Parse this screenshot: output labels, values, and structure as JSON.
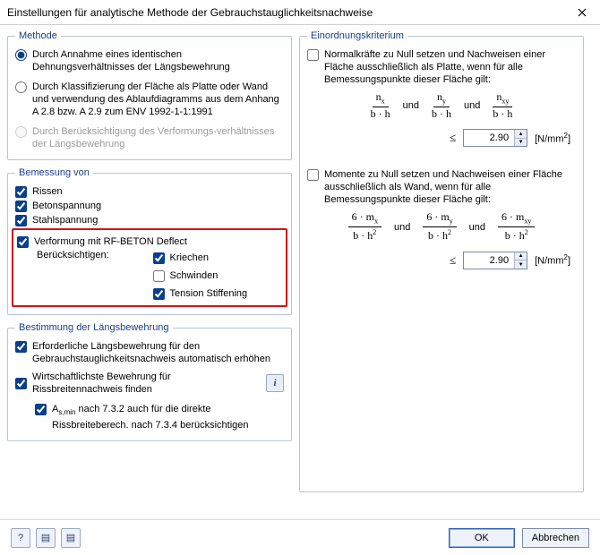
{
  "title": "Einstellungen für analytische Methode der Gebrauchstauglichkeitsnachweise",
  "methode": {
    "legend": "Methode",
    "opt1": "Durch Annahme eines identischen Dehnungsverhältnisses der Längsbewehrung",
    "opt2": "Durch Klassifizierung der Fläche als Platte oder Wand und verwendung des Ablaufdiagramms aus dem Anhang A 2.8 bzw. A 2.9 zum ENV 1992-1-1:1991",
    "opt3": "Durch Berücksichtigung des Verformungs-verhältnisses der Längsbewehrung"
  },
  "bemessung": {
    "legend": "Bemessung von",
    "rissen": "Rissen",
    "betonspannung": "Betonspannung",
    "stahlspannung": "Stahlspannung",
    "deflect": "Verformung mit RF-BETON Deflect",
    "beruck_label": "Berücksichtigen:",
    "kriechen": "Kriechen",
    "schwinden": "Schwinden",
    "tension": "Tension Stiffening"
  },
  "longitudinal": {
    "legend": "Bestimmung der Längsbewehrung",
    "erf": "Erforderliche Längsbewehrung für den Gebrauchstauglichkeitsnachweis automatisch erhöhen",
    "wirt": "Wirtschaftlichste Bewehrung für Rissbreitennachweis finden",
    "asmin_pre": "A",
    "asmin_post": " nach 7.3.2 auch für die direkte Rissbreiteberech. nach 7.3.4 berücksichtigen"
  },
  "criteria": {
    "legend": "Einordnungskriterium",
    "normal_label": "Normalkräfte zu Null setzen und Nachweisen einer Fläche ausschließlich als Platte, wenn für alle Bemessungspunkte dieser Fläche gilt:",
    "moment_label": "Momente zu Null setzen und Nachweisen einer Fläche ausschließlich als Wand, wenn für alle Bemessungspunkte dieser Fläche gilt:",
    "und": "und",
    "normal_value": "2.90",
    "moment_value": "2.90",
    "unit_pre": "[N/mm",
    "unit_post": "]",
    "leq": "≤",
    "n_frac": [
      {
        "num_var": "n",
        "num_sub": "x",
        "den": "b · h"
      },
      {
        "num_var": "n",
        "num_sub": "y",
        "den": "b · h"
      },
      {
        "num_var": "n",
        "num_sub": "xy",
        "den": "b · h"
      }
    ],
    "m_frac": [
      {
        "num_pre": "6 · m",
        "num_sub": "x",
        "den_pre": "b · h",
        "den_exp": "2"
      },
      {
        "num_pre": "6 · m",
        "num_sub": "y",
        "den_pre": "b · h",
        "den_exp": "2"
      },
      {
        "num_pre": "6 · m",
        "num_sub": "xy",
        "den_pre": "b · h",
        "den_exp": "2"
      }
    ]
  },
  "buttons": {
    "ok": "OK",
    "cancel": "Abbrechen"
  }
}
